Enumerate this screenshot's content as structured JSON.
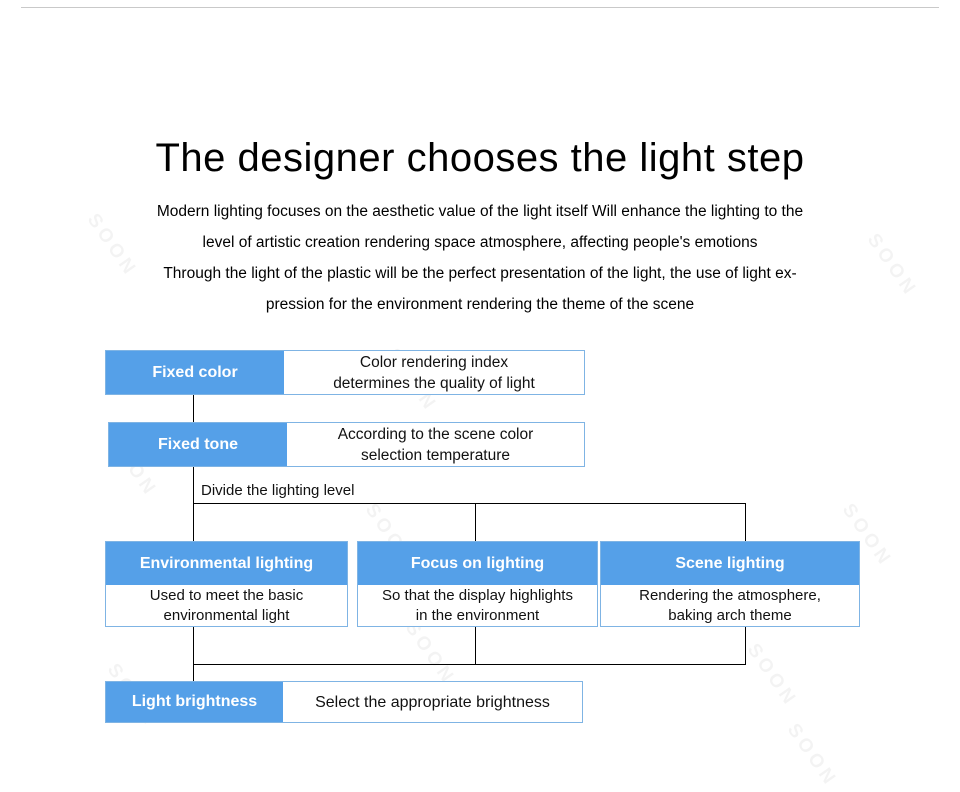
{
  "page": {
    "title": "The designer chooses the light step",
    "watermark_text": "SOON",
    "accent_blue": "#55a0e8",
    "border_blue": "#7fb4e4",
    "rule_color": "#c9c9c9"
  },
  "intro": {
    "lines": [
      "Modern lighting focuses on the aesthetic value of the light itself Will enhance the lighting to the",
      "level of artistic creation rendering space atmosphere, affecting people's emotions",
      "Through the light of the plastic will be the perfect presentation of the light, the use of light ex-",
      "pression for the environment rendering the theme of the scene"
    ]
  },
  "flow": {
    "divide_label": "Divide the lighting level",
    "step_fixed_color": {
      "label": "Fixed color",
      "body": "Color rendering index\ndetermines the quality of light",
      "body_line1": "Color rendering index",
      "body_line2": "determines the quality of light"
    },
    "step_fixed_tone": {
      "label": "Fixed tone",
      "body_line1": "According to the scene color",
      "body_line2": "selection temperature"
    },
    "branches": [
      {
        "label": "Environmental lighting",
        "body_line1": "Used to meet the basic",
        "body_line2": "environmental light"
      },
      {
        "label": "Focus on lighting",
        "body_line1": "So that the display highlights",
        "body_line2": "in the environment"
      },
      {
        "label": "Scene lighting",
        "body_line1": "Rendering the atmosphere,",
        "body_line2": "baking arch theme"
      }
    ],
    "step_light_brightness": {
      "label": "Light brightness",
      "body": "Select the appropriate brightness"
    }
  }
}
